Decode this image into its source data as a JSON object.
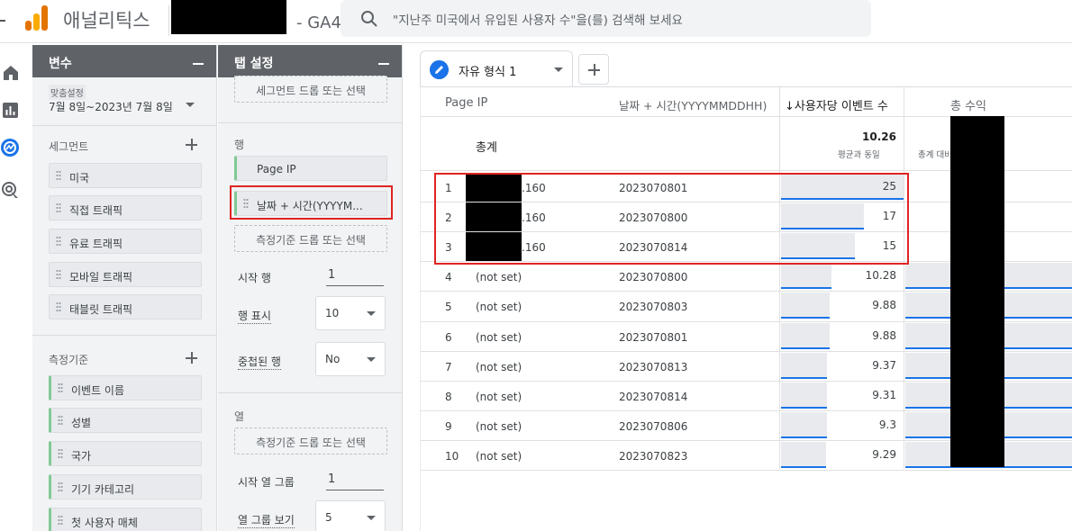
{
  "header": {
    "app_title": "애널리틱스",
    "property_suffix": "- GA4",
    "search_placeholder": "\"지난주 미국에서 유입된 사용자 수\"을(를) 검색해 보세요"
  },
  "colors": {
    "accent": "#1a73e8",
    "highlight": "#e02424",
    "panel_header": "#5f6368"
  },
  "left_nav": [
    "home-icon",
    "reports-icon",
    "explore-icon",
    "advertising-icon"
  ],
  "variables_panel": {
    "title": "변수",
    "date_label": "맞춤설정",
    "date_range": "7월 8일~2023년 7월 8일",
    "segments_title": "세그먼트",
    "segments": [
      "미국",
      "직접 트래픽",
      "유료 트래픽",
      "모바일 트래픽",
      "태블릿 트래픽"
    ],
    "metrics_title": "측정기준",
    "dimensions": [
      "이벤트 이름",
      "성별",
      "국가",
      "기기 카테고리",
      "첫 사용자 매체"
    ]
  },
  "tab_settings": {
    "title": "탭 설정",
    "segment_drop": "세그먼트 드롭 또는 선택",
    "rows_title": "행",
    "rows": [
      "Page IP",
      "날짜 + 시간(YYYYM..."
    ],
    "dim_drop": "측정기준 드롭 또는 선택",
    "start_row_label": "시작 행",
    "start_row_value": "1",
    "show_rows_label": "행 표시",
    "show_rows_value": "10",
    "nested_rows_label": "중첩된 행",
    "nested_rows_value": "No",
    "columns_title": "열",
    "col_dim_drop": "측정기준 드롭 또는 선택",
    "start_col_group_label": "시작 열 그룹",
    "start_col_group_value": "1",
    "show_col_groups_label": "열 그룹 보기",
    "show_col_groups_value": "5"
  },
  "tabs": {
    "active": "자유 형식 1"
  },
  "table": {
    "headers": [
      "Page IP",
      "날짜 + 시간(YYYYMMDDHH)",
      "↓사용자당 이벤트 수",
      "총 수익"
    ],
    "total_label": "총계",
    "total_value": "10.26",
    "total_sub": "평균과 동일",
    "total_revenue_sub": "총계 대비",
    "rows": [
      {
        "n": "1",
        "ip": ".160",
        "dt": "2023070801",
        "v": "25",
        "f": 1.0
      },
      {
        "n": "2",
        "ip": ".160",
        "dt": "2023070800",
        "v": "17",
        "f": 0.68
      },
      {
        "n": "3",
        "ip": ".160",
        "dt": "2023070814",
        "v": "15",
        "f": 0.6
      },
      {
        "n": "4",
        "ip": "(not set)",
        "dt": "2023070800",
        "v": "10.28",
        "f": 0.41
      },
      {
        "n": "5",
        "ip": "(not set)",
        "dt": "2023070803",
        "v": "9.88",
        "f": 0.395
      },
      {
        "n": "6",
        "ip": "(not set)",
        "dt": "2023070801",
        "v": "9.88",
        "f": 0.395
      },
      {
        "n": "7",
        "ip": "(not set)",
        "dt": "2023070813",
        "v": "9.37",
        "f": 0.375
      },
      {
        "n": "8",
        "ip": "(not set)",
        "dt": "2023070814",
        "v": "9.31",
        "f": 0.372
      },
      {
        "n": "9",
        "ip": "(not set)",
        "dt": "2023070806",
        "v": "9.3",
        "f": 0.372
      },
      {
        "n": "10",
        "ip": "(not set)",
        "dt": "2023070823",
        "v": "9.29",
        "f": 0.371
      }
    ]
  }
}
